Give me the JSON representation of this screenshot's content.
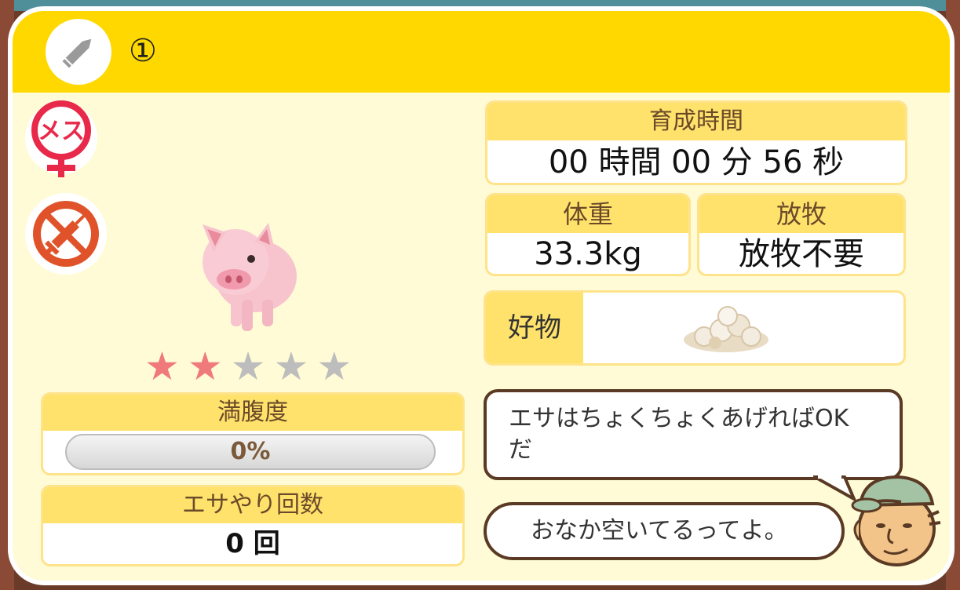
{
  "header": {
    "title": "①",
    "edit_icon": "pencil-icon"
  },
  "pig": {
    "gender_icon": "female-symbol-icon",
    "gender_label": "メス",
    "injection_icon": "no-injection-icon",
    "rating": 2,
    "rating_max": 5
  },
  "stats": {
    "raising_time_label": "育成時間",
    "raising_time_value": "00 時間 00 分 56 秒",
    "weight_label": "体重",
    "weight_value": "33.3kg",
    "grazing_label": "放牧",
    "grazing_value": "放牧不要",
    "favorite_label": "好物",
    "favorite_icon": "feed-pile-icon"
  },
  "fullness": {
    "label": "満腹度",
    "value_text": "0%",
    "value": 0
  },
  "feed_count": {
    "label": "エサやり回数",
    "value": "0 回"
  },
  "messages": {
    "advice": "エサはちょくちょくあげればOK だ",
    "status": "おなか空いてるってよ。"
  },
  "colors": {
    "header": "#ffd800",
    "card_bg": "#fffbd6",
    "panel_header": "#ffe26b",
    "star_on": "#f07a7a",
    "star_off": "#bdbdbd",
    "gender_accent": "#e8294a",
    "injection_accent": "#e0532a"
  }
}
